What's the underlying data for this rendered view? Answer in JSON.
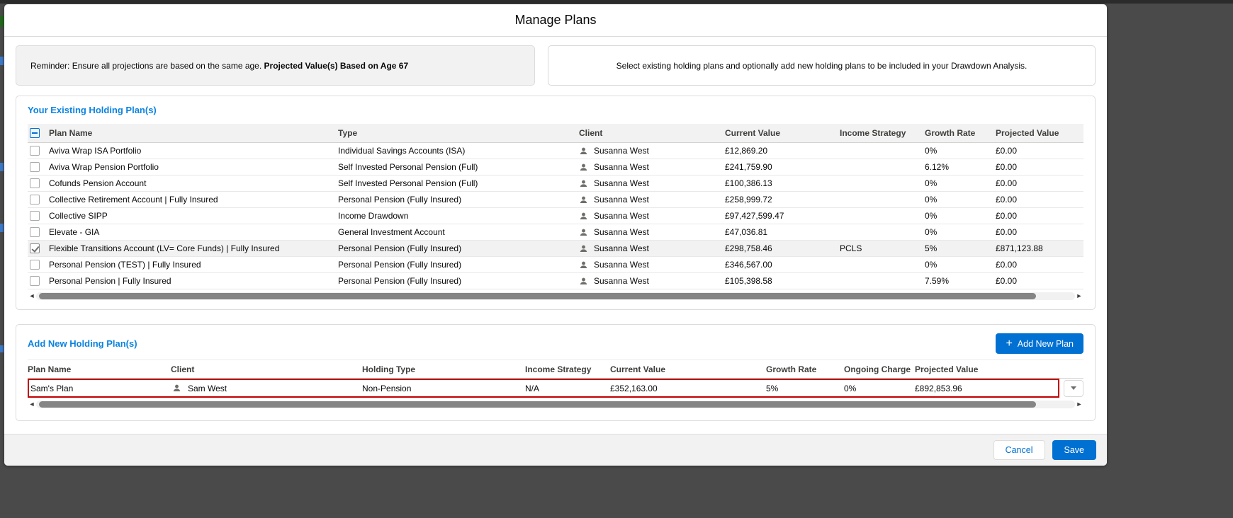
{
  "modal": {
    "title": "Manage Plans"
  },
  "info": {
    "reminder_text": "Reminder: Ensure all projections are based on the same age.",
    "reminder_bold": "Projected Value(s) Based on Age 67",
    "instruction": "Select existing holding plans and optionally add new holding plans to be included in your Drawdown Analysis."
  },
  "existing_section": {
    "heading": "Your Existing Holding Plan(s)",
    "select_all_state": "indeterminate",
    "columns": [
      "Plan Name",
      "Type",
      "Client",
      "Current Value",
      "Income Strategy",
      "Growth Rate",
      "Projected Value"
    ],
    "rows": [
      {
        "checked": false,
        "plan_name": "Aviva Wrap ISA Portfolio",
        "type": "Individual Savings Accounts (ISA)",
        "client": "Susanna West",
        "current_value": "£12,869.20",
        "income_strategy": "",
        "growth_rate": "0%",
        "projected_value": "£0.00"
      },
      {
        "checked": false,
        "plan_name": "Aviva Wrap Pension Portfolio",
        "type": "Self Invested Personal Pension (Full)",
        "client": "Susanna West",
        "current_value": "£241,759.90",
        "income_strategy": "",
        "growth_rate": "6.12%",
        "projected_value": "£0.00"
      },
      {
        "checked": false,
        "plan_name": "Cofunds Pension Account",
        "type": "Self Invested Personal Pension (Full)",
        "client": "Susanna West",
        "current_value": "£100,386.13",
        "income_strategy": "",
        "growth_rate": "0%",
        "projected_value": "£0.00"
      },
      {
        "checked": false,
        "plan_name": "Collective Retirement Account | Fully Insured",
        "type": "Personal Pension (Fully Insured)",
        "client": "Susanna West",
        "current_value": "£258,999.72",
        "income_strategy": "",
        "growth_rate": "0%",
        "projected_value": "£0.00"
      },
      {
        "checked": false,
        "plan_name": "Collective SIPP",
        "type": "Income Drawdown",
        "client": "Susanna West",
        "current_value": "£97,427,599.47",
        "income_strategy": "",
        "growth_rate": "0%",
        "projected_value": "£0.00"
      },
      {
        "checked": false,
        "plan_name": "Elevate - GIA",
        "type": "General Investment Account",
        "client": "Susanna West",
        "current_value": "£47,036.81",
        "income_strategy": "",
        "growth_rate": "0%",
        "projected_value": "£0.00"
      },
      {
        "checked": true,
        "plan_name": "Flexible Transitions Account (LV= Core Funds) | Fully Insured",
        "type": "Personal Pension (Fully Insured)",
        "client": "Susanna West",
        "current_value": "£298,758.46",
        "income_strategy": "PCLS",
        "growth_rate": "5%",
        "projected_value": "£871,123.88"
      },
      {
        "checked": false,
        "plan_name": "Personal Pension (TEST) | Fully Insured",
        "type": "Personal Pension (Fully Insured)",
        "client": "Susanna West",
        "current_value": "£346,567.00",
        "income_strategy": "",
        "growth_rate": "0%",
        "projected_value": "£0.00"
      },
      {
        "checked": false,
        "plan_name": "Personal Pension | Fully Insured",
        "type": "Personal Pension (Fully Insured)",
        "client": "Susanna West",
        "current_value": "£105,398.58",
        "income_strategy": "",
        "growth_rate": "7.59%",
        "projected_value": "£0.00"
      }
    ]
  },
  "new_section": {
    "heading": "Add New Holding Plan(s)",
    "add_button_label": "Add New Plan",
    "columns": [
      "Plan Name",
      "Client",
      "Holding Type",
      "Income Strategy",
      "Current Value",
      "Growth Rate",
      "Ongoing Charge",
      "Projected Value"
    ],
    "rows": [
      {
        "plan_name": "Sam's Plan",
        "client": "Sam West",
        "holding_type": "Non-Pension",
        "income_strategy": "N/A",
        "current_value": "£352,163.00",
        "growth_rate": "5%",
        "ongoing_charge": "0%",
        "projected_value": "£892,853.96"
      }
    ]
  },
  "footer": {
    "cancel": "Cancel",
    "save": "Save"
  },
  "icons": {
    "person": "person-silhouette",
    "dropdown": "caret-down",
    "plus": "+",
    "scroll_left": "◄",
    "scroll_right": "►"
  },
  "colors": {
    "accent": "#0070d2",
    "section_heading": "#0b83e0",
    "new_row_highlight_border": "#c00000",
    "selected_row_background": "#f3f2f2"
  }
}
